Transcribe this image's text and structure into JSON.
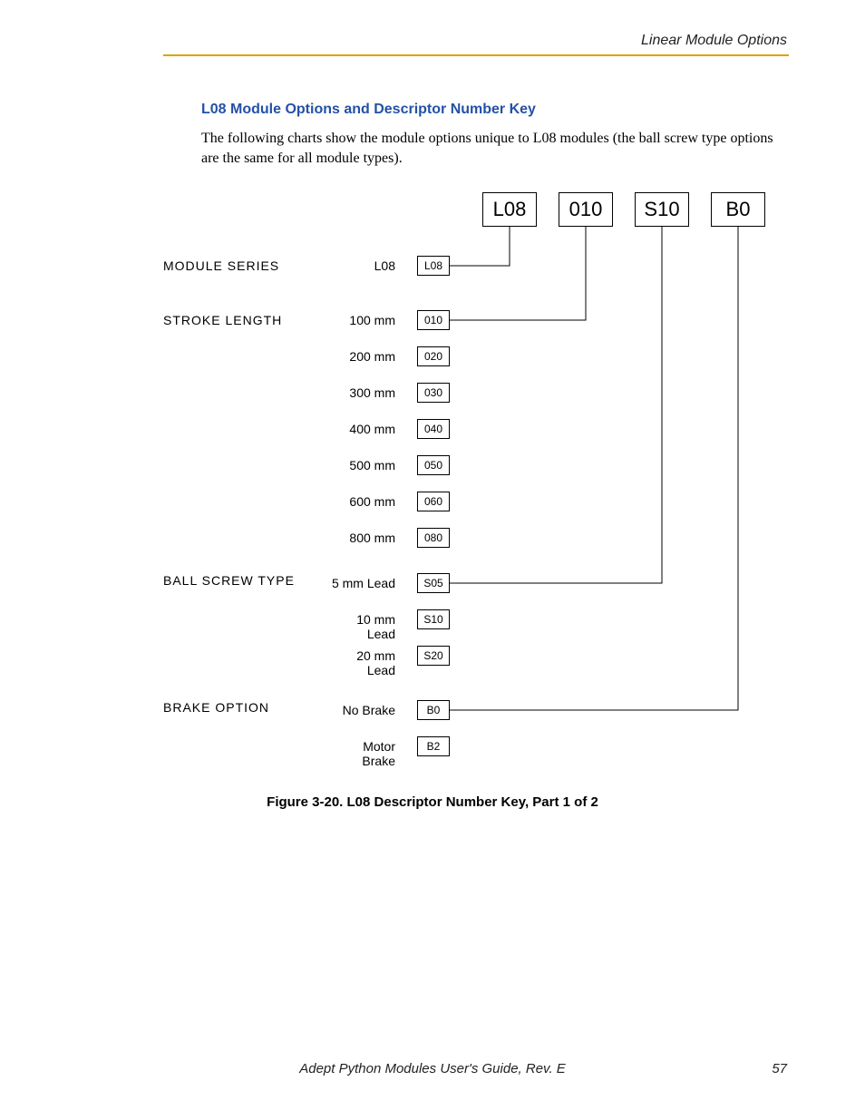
{
  "header": {
    "section": "Linear Module Options"
  },
  "heading": "L08 Module Options and Descriptor Number Key",
  "intro": "The following charts show the module options unique to L08 modules (the ball screw type options are the same for all module types).",
  "descriptor": {
    "d1": "L08",
    "d2": "010",
    "d3": "S10",
    "d4": "B0"
  },
  "module_series": {
    "label": "MODULE  SERIES",
    "options": [
      {
        "desc": "L08",
        "code": "L08"
      }
    ]
  },
  "stroke_length": {
    "label": "STROKE  LENGTH",
    "options": [
      {
        "desc": "100 mm",
        "code": "010"
      },
      {
        "desc": "200 mm",
        "code": "020"
      },
      {
        "desc": "300 mm",
        "code": "030"
      },
      {
        "desc": "400 mm",
        "code": "040"
      },
      {
        "desc": "500 mm",
        "code": "050"
      },
      {
        "desc": "600 mm",
        "code": "060"
      },
      {
        "desc": "800 mm",
        "code": "080"
      }
    ]
  },
  "ball_screw": {
    "label": "BALL  SCREW  TYPE",
    "options": [
      {
        "desc": "5 mm Lead",
        "code": "S05"
      },
      {
        "desc": "10 mm Lead",
        "code": "S10"
      },
      {
        "desc": "20 mm Lead",
        "code": "S20"
      }
    ]
  },
  "brake": {
    "label": "BRAKE  OPTION",
    "options": [
      {
        "desc": "No Brake",
        "code": "B0"
      },
      {
        "desc": "Motor Brake",
        "code": "B2"
      }
    ]
  },
  "figure_caption": "Figure 3-20. L08 Descriptor Number Key, Part 1 of 2",
  "footer": {
    "title": "Adept Python Modules User's Guide, Rev. E",
    "page": "57"
  }
}
